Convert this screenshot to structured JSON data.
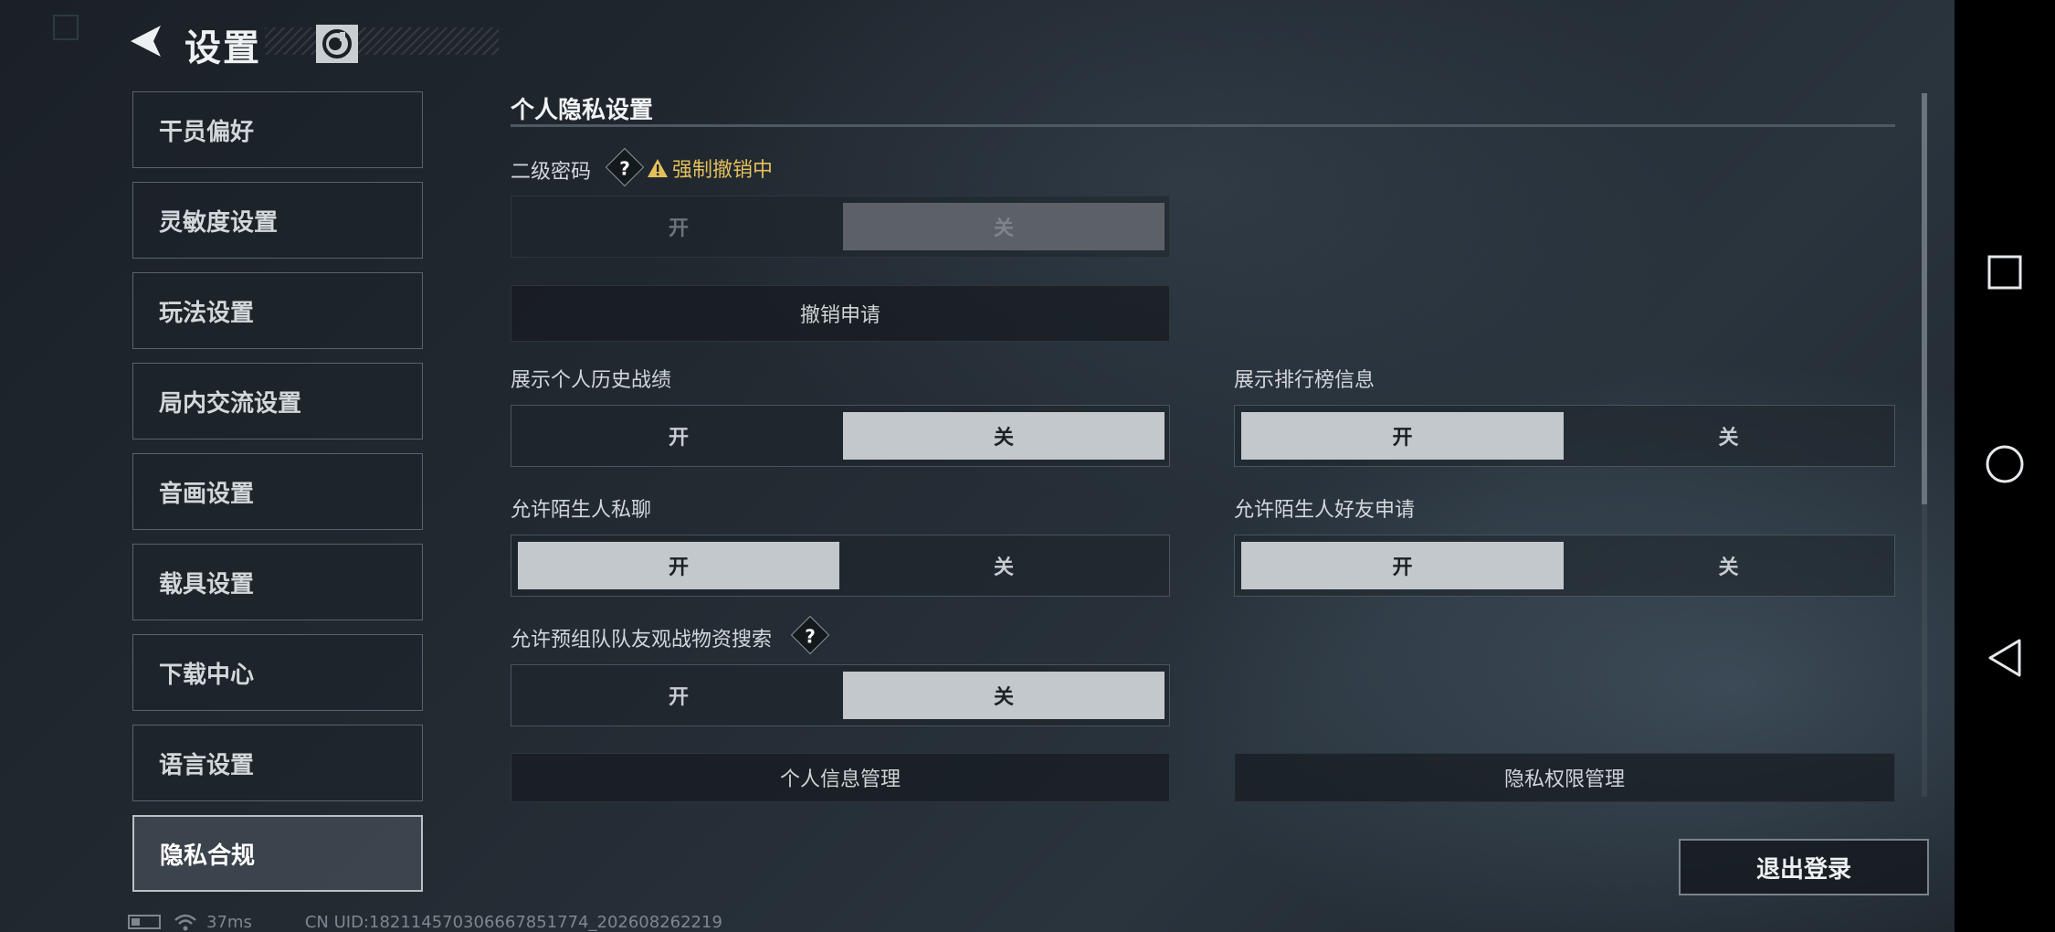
{
  "header": {
    "title": "设置"
  },
  "sidebar": {
    "items": [
      {
        "label": "干员偏好"
      },
      {
        "label": "灵敏度设置"
      },
      {
        "label": "玩法设置"
      },
      {
        "label": "局内交流设置"
      },
      {
        "label": "音画设置"
      },
      {
        "label": "载具设置"
      },
      {
        "label": "下载中心"
      },
      {
        "label": "语言设置"
      },
      {
        "label": "隐私合规",
        "active": true
      }
    ]
  },
  "main": {
    "section_title": "个人隐私设置",
    "secondary_password": {
      "label": "二级密码",
      "help": "?",
      "warning": "强制撤销中",
      "on": "开",
      "off": "关",
      "selected": "off",
      "disabled": true
    },
    "cancel_request_label": "撤销申请",
    "show_history": {
      "label": "展示个人历史战绩",
      "on": "开",
      "off": "关",
      "selected": "off"
    },
    "show_leaderboard": {
      "label": "展示排行榜信息",
      "on": "开",
      "off": "关",
      "selected": "on"
    },
    "stranger_chat": {
      "label": "允许陌生人私聊",
      "on": "开",
      "off": "关",
      "selected": "on"
    },
    "stranger_friend": {
      "label": "允许陌生人好友申请",
      "on": "开",
      "off": "关",
      "selected": "on"
    },
    "team_search": {
      "label": "允许预组队队友观战物资搜索",
      "help": "?",
      "on": "开",
      "off": "关",
      "selected": "off"
    },
    "personal_info_label": "个人信息管理",
    "privacy_permission_label": "隐私权限管理",
    "logout_label": "退出登录"
  },
  "status_bar": {
    "ping": "37ms",
    "uid": "CN UID:18211457030666785177​4_202608262219"
  },
  "colors": {
    "selected_option": "#c3c8cc",
    "warning": "#e4c05a"
  }
}
